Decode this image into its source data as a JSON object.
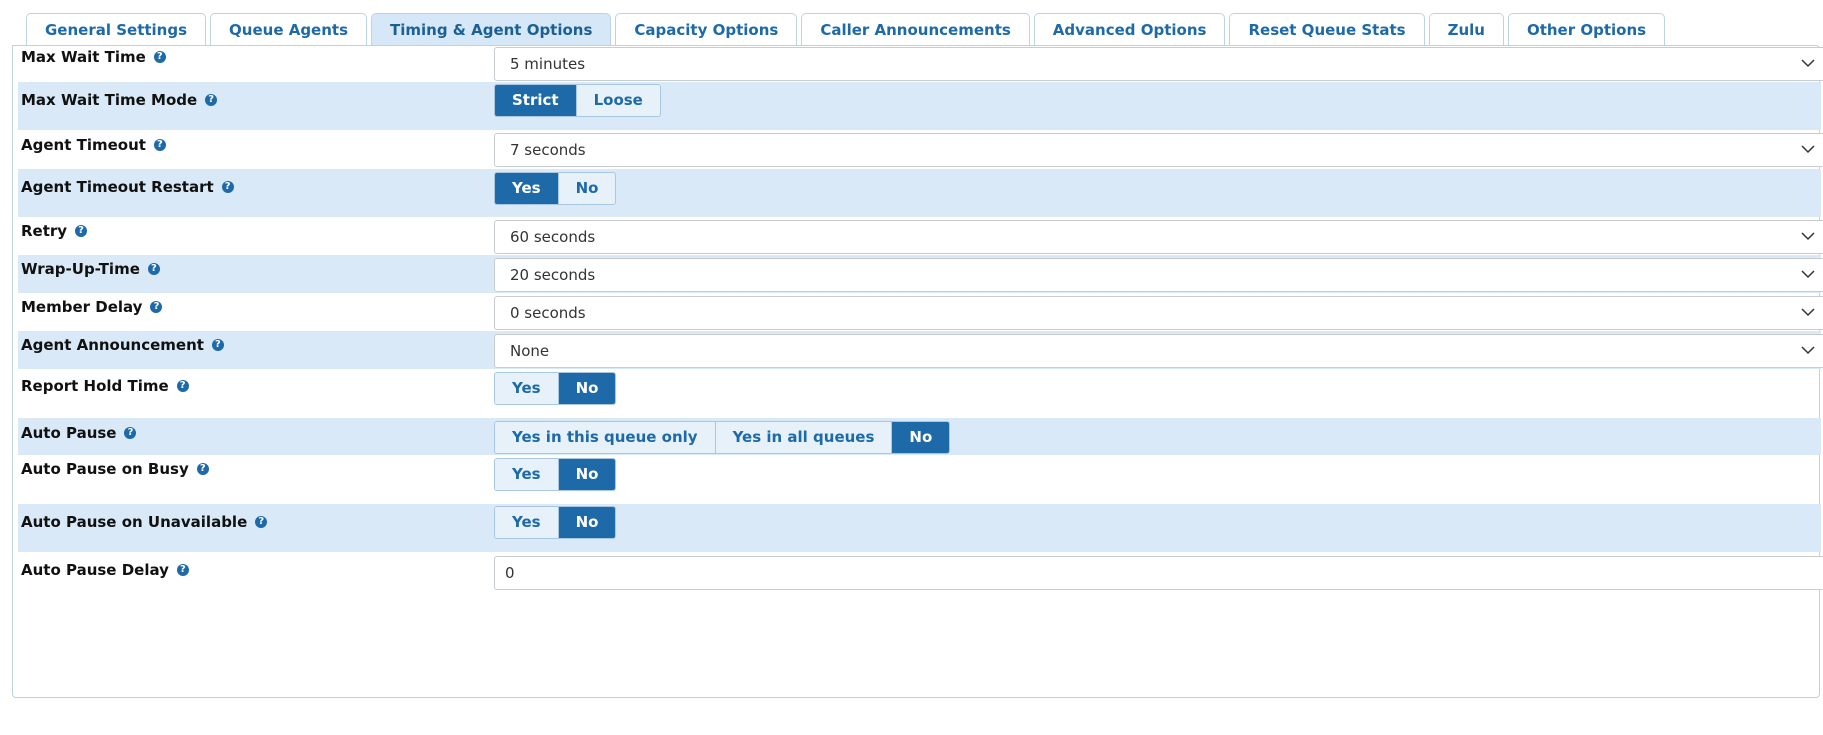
{
  "tabs": [
    "General Settings",
    "Queue Agents",
    "Timing & Agent Options",
    "Capacity Options",
    "Caller Announcements",
    "Advanced Options",
    "Reset Queue Stats",
    "Zulu",
    "Other Options"
  ],
  "active_tab_index": 2,
  "help_icon": "?",
  "fields": {
    "max_wait_time": {
      "label": "Max Wait Time",
      "value": "5 minutes"
    },
    "max_wait_time_mode": {
      "label": "Max Wait Time Mode",
      "options": [
        "Strict",
        "Loose"
      ],
      "selected": "Strict"
    },
    "agent_timeout": {
      "label": "Agent Timeout",
      "value": "7 seconds"
    },
    "agent_timeout_restart": {
      "label": "Agent Timeout Restart",
      "options": [
        "Yes",
        "No"
      ],
      "selected": "Yes"
    },
    "retry": {
      "label": "Retry",
      "value": "60 seconds"
    },
    "wrap_up_time": {
      "label": "Wrap-Up-Time",
      "value": "20 seconds"
    },
    "member_delay": {
      "label": "Member Delay",
      "value": "0 seconds"
    },
    "agent_announcement": {
      "label": "Agent Announcement",
      "value": "None"
    },
    "report_hold_time": {
      "label": "Report Hold Time",
      "options": [
        "Yes",
        "No"
      ],
      "selected": "No"
    },
    "auto_pause": {
      "label": "Auto Pause",
      "options": [
        "Yes in this queue only",
        "Yes in all queues",
        "No"
      ],
      "selected": "No"
    },
    "auto_pause_busy": {
      "label": "Auto Pause on Busy",
      "options": [
        "Yes",
        "No"
      ],
      "selected": "No"
    },
    "auto_pause_unavailable": {
      "label": "Auto Pause on Unavailable",
      "options": [
        "Yes",
        "No"
      ],
      "selected": "No"
    },
    "auto_pause_delay": {
      "label": "Auto Pause Delay",
      "value": "0"
    }
  },
  "colors": {
    "accent": "#1e6aa8",
    "row_alt": "#d9e9f7",
    "border": "#bcd3e5"
  }
}
